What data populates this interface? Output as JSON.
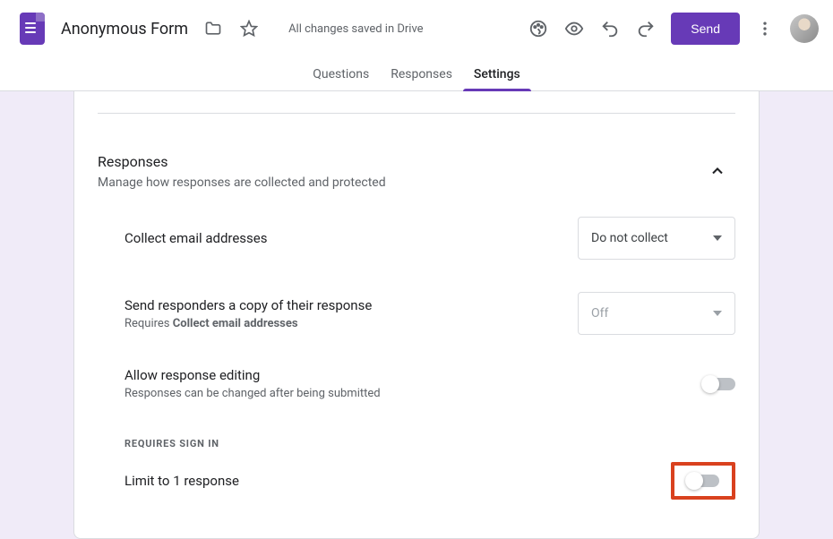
{
  "header": {
    "form_title": "Anonymous Form",
    "save_status": "All changes saved in Drive",
    "send_label": "Send"
  },
  "tabs": {
    "questions": "Questions",
    "responses": "Responses",
    "settings": "Settings",
    "active": "settings"
  },
  "section": {
    "title": "Responses",
    "desc": "Manage how responses are collected and protected"
  },
  "rows": {
    "collect_email": {
      "label": "Collect email addresses",
      "select_value": "Do not collect"
    },
    "send_copy": {
      "label": "Send responders a copy of their response",
      "sub_prefix": "Requires ",
      "sub_bold": "Collect email addresses",
      "select_value": "Off"
    },
    "allow_edit": {
      "label": "Allow response editing",
      "sub": "Responses can be changed after being submitted"
    },
    "subheader": "REQUIRES SIGN IN",
    "limit_one": {
      "label": "Limit to 1 response"
    }
  }
}
